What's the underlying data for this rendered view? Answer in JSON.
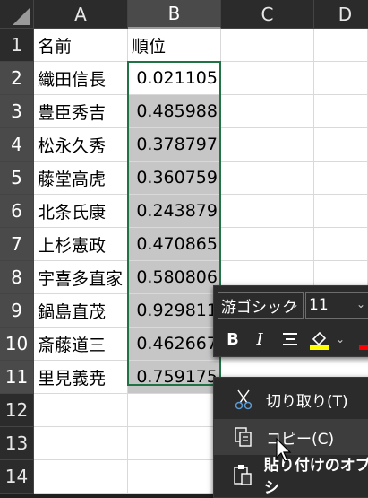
{
  "columns": [
    "A",
    "B",
    "C",
    "D"
  ],
  "rows": [
    "1",
    "2",
    "3",
    "4",
    "5",
    "6",
    "7",
    "8",
    "9",
    "10",
    "11",
    "12",
    "13",
    "14"
  ],
  "table": {
    "header": {
      "name": "名前",
      "rank": "順位"
    },
    "records": [
      {
        "name": "織田信長",
        "rank": "0.021105"
      },
      {
        "name": "豊臣秀吉",
        "rank": "0.485988"
      },
      {
        "name": "松永久秀",
        "rank": "0.378797"
      },
      {
        "name": "藤堂高虎",
        "rank": "0.360759"
      },
      {
        "name": "北条氏康",
        "rank": "0.243879"
      },
      {
        "name": "上杉憲政",
        "rank": "0.470865"
      },
      {
        "name": "宇喜多直家",
        "rank": "0.580806"
      },
      {
        "name": "鍋島直茂",
        "rank": "0.929811"
      },
      {
        "name": "斎藤道三",
        "rank": "0.462667"
      },
      {
        "name": "里見義尭",
        "rank": "0.759175"
      }
    ]
  },
  "mini_toolbar": {
    "font_name": "游ゴシック",
    "font_size": "11",
    "bold": "B",
    "italic": "I",
    "fill_color": "#ffff00",
    "font_color": "#ff0000"
  },
  "context_menu": {
    "cut": "切り取り(T)",
    "copy": "コピー(C)",
    "paste_options": "貼り付けのオプシ"
  },
  "colors": {
    "selection_border": "#217346",
    "selection_fill": "#c6c6c6",
    "header_bg": "#2b2b2b"
  }
}
